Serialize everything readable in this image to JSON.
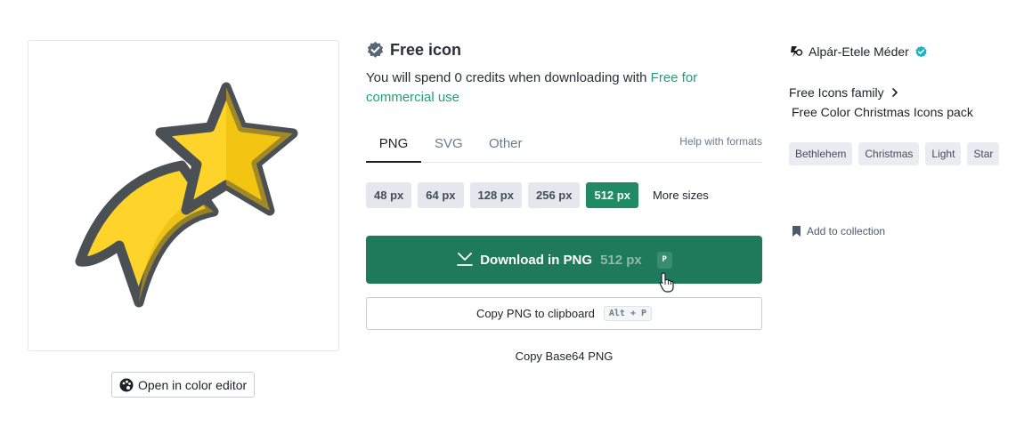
{
  "preview": {
    "icon_name": "shooting-star-icon",
    "color_editor_label": "Open in color editor"
  },
  "header": {
    "title": "Free icon",
    "credits_text": "You will spend 0 credits when downloading with ",
    "credits_link": "Free for commercial use"
  },
  "formats": {
    "tabs": [
      {
        "label": "PNG",
        "active": true
      },
      {
        "label": "SVG",
        "active": false
      },
      {
        "label": "Other",
        "active": false
      }
    ],
    "help_label": "Help with formats"
  },
  "sizes": {
    "options": [
      "48 px",
      "64 px",
      "128 px",
      "256 px",
      "512 px"
    ],
    "selected": "512 px",
    "more_label": "More sizes"
  },
  "download": {
    "label": "Download in PNG",
    "size": "512 px",
    "shortcut": "P"
  },
  "copy_clipboard": {
    "label": "Copy PNG to clipboard",
    "shortcut": "Alt + P"
  },
  "copy_base64": {
    "label": "Copy Base64 PNG"
  },
  "author": {
    "name": "Alpár-Etele Méder"
  },
  "family": {
    "label": "Free Icons family",
    "pack": "Free Color Christmas Icons pack"
  },
  "tags": [
    "Bethlehem",
    "Christmas",
    "Light",
    "Star"
  ],
  "collection": {
    "label": "Add to collection"
  },
  "colors": {
    "accent_green": "#1f8a63",
    "download_green": "#1f7a5c",
    "link_green": "#1ea174",
    "star_yellow": "#ffd42a",
    "outline_gray": "#4a5054"
  }
}
